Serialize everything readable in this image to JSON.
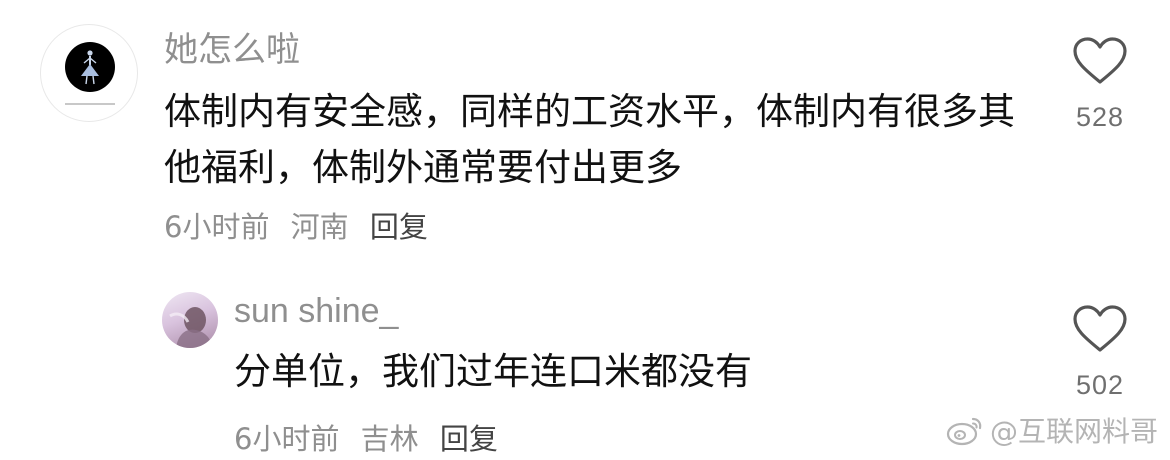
{
  "comments": [
    {
      "username": "她怎么啦",
      "text": "体制内有安全感，同样的工资水平，体制内有很多其他福利，体制外通常要付出更多",
      "time": "6小时前",
      "location": "河南",
      "reply_label": "回复",
      "likes": "528",
      "avatar_icon": "ballerina-silhouette-avatar"
    },
    {
      "username": "sun shine_",
      "text": "分单位，我们过年连口米都没有",
      "time": "6小时前",
      "location": "吉林",
      "reply_label": "回复",
      "likes": "502",
      "avatar_icon": "person-photo-avatar"
    }
  ],
  "watermark": {
    "text": "@互联网料哥",
    "icon": "weibo-logo-icon"
  },
  "colors": {
    "username": "#8f8f8f",
    "body_text": "#111111",
    "meta": "#8f8f8f",
    "like_icon": "#555555",
    "watermark": "#b4b4b4"
  }
}
